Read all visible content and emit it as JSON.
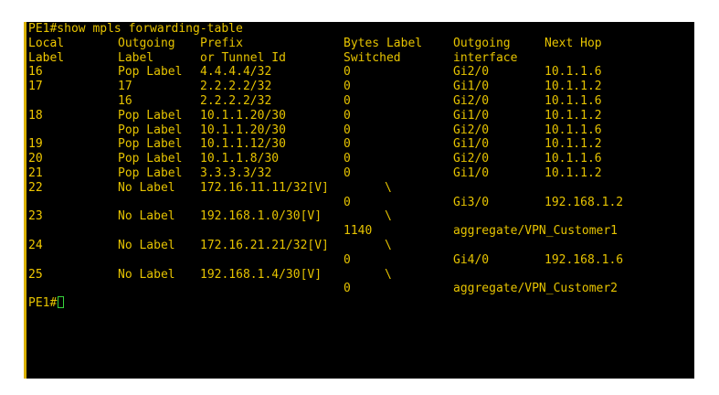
{
  "window": {
    "command_line": "PE1#show mpls forwarding-table",
    "prompt": "PE1#"
  },
  "table": {
    "header_row1": [
      "Local",
      "Outgoing",
      "Prefix",
      "Bytes Label",
      "Outgoing",
      "Next Hop"
    ],
    "header_row2": [
      "Label",
      "Label",
      "or Tunnel Id",
      "Switched",
      "interface",
      ""
    ],
    "rows": [
      [
        "16",
        "Pop Label",
        "4.4.4.4/32",
        "0",
        "Gi2/0",
        "10.1.1.6"
      ],
      [
        "17",
        "17",
        "2.2.2.2/32",
        "0",
        "Gi1/0",
        "10.1.1.2"
      ],
      [
        "",
        "16",
        "2.2.2.2/32",
        "0",
        "Gi2/0",
        "10.1.1.6"
      ],
      [
        "18",
        "Pop Label",
        "10.1.1.20/30",
        "0",
        "Gi1/0",
        "10.1.1.2"
      ],
      [
        "",
        "Pop Label",
        "10.1.1.20/30",
        "0",
        "Gi2/0",
        "10.1.1.6"
      ],
      [
        "19",
        "Pop Label",
        "10.1.1.12/30",
        "0",
        "Gi1/0",
        "10.1.1.2"
      ],
      [
        "20",
        "Pop Label",
        "10.1.1.8/30",
        "0",
        "Gi2/0",
        "10.1.1.6"
      ],
      [
        "21",
        "Pop Label",
        "3.3.3.3/32",
        "0",
        "Gi1/0",
        "10.1.1.2"
      ],
      [
        "22",
        "No Label",
        "172.16.11.11/32[V]",
        "\\",
        "",
        ""
      ],
      [
        "",
        "",
        "",
        "0",
        "Gi3/0",
        "192.168.1.2"
      ],
      [
        "23",
        "No Label",
        "192.168.1.0/30[V]",
        "\\",
        "",
        ""
      ],
      [
        "",
        "",
        "",
        "1140",
        "aggregate/VPN_Customer1",
        ""
      ],
      [
        "24",
        "No Label",
        "172.16.21.21/32[V]",
        "\\",
        "",
        ""
      ],
      [
        "",
        "",
        "",
        "0",
        "Gi4/0",
        "192.168.1.6"
      ],
      [
        "25",
        "No Label",
        "192.168.1.4/30[V]",
        "\\",
        "",
        ""
      ],
      [
        "",
        "",
        "",
        "0",
        "aggregate/VPN_Customer2",
        ""
      ]
    ]
  },
  "colors": {
    "background": "#000000",
    "text": "#e6c300",
    "cursor": "#36d33b"
  }
}
